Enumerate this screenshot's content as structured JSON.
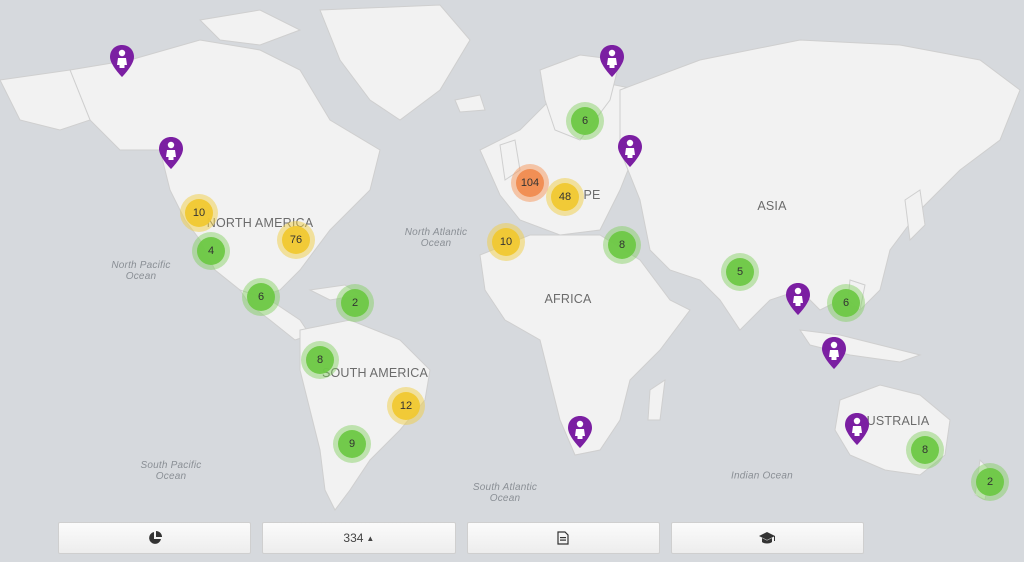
{
  "map": {
    "continents": [
      "NORTH AMERICA",
      "SOUTH AMERICA",
      "EUROPE",
      "AFRICA",
      "ASIA",
      "AUSTRALIA"
    ],
    "continent_labels": {
      "north_america": "NORTH AMERICA",
      "south_america": "SOUTH AMERICA",
      "europe": "PE",
      "africa": "AFRICA",
      "asia": "ASIA",
      "australia": "USTRALIA"
    },
    "oceans": {
      "north_pacific": "North Pacific\nOcean",
      "south_pacific": "South Pacific\nOcean",
      "north_atlantic": "North Atlantic\nOcean",
      "south_atlantic": "South Atlantic\nOcean",
      "indian": "Indian Ocean"
    },
    "clusters": [
      {
        "id": "c1",
        "count": "10",
        "color": "yellow"
      },
      {
        "id": "c2",
        "count": "4",
        "color": "green"
      },
      {
        "id": "c3",
        "count": "76",
        "color": "yellow"
      },
      {
        "id": "c4",
        "count": "6",
        "color": "green"
      },
      {
        "id": "c5",
        "count": "2",
        "color": "green"
      },
      {
        "id": "c6",
        "count": "8",
        "color": "green"
      },
      {
        "id": "c7",
        "count": "12",
        "color": "yellow"
      },
      {
        "id": "c8",
        "count": "9",
        "color": "green"
      },
      {
        "id": "c9",
        "count": "6",
        "color": "green"
      },
      {
        "id": "c10",
        "count": "104",
        "color": "orange"
      },
      {
        "id": "c11",
        "count": "48",
        "color": "yellow"
      },
      {
        "id": "c12",
        "count": "10",
        "color": "yellow"
      },
      {
        "id": "c13",
        "count": "8",
        "color": "green"
      },
      {
        "id": "c14",
        "count": "5",
        "color": "green"
      },
      {
        "id": "c15",
        "count": "6",
        "color": "green"
      },
      {
        "id": "c16",
        "count": "8",
        "color": "green"
      },
      {
        "id": "c17",
        "count": "2",
        "color": "green"
      }
    ],
    "pin_icon": "person-marker-icon",
    "pin_color": "#7b1fa2"
  },
  "toolbar": {
    "chart_button_icon": "pie-chart-icon",
    "count_label": "334",
    "count_caret": "▲",
    "document_button_icon": "document-icon",
    "education_button_icon": "graduation-cap-icon"
  },
  "colors": {
    "water": "#d6d9dd",
    "land": "#f2f2f2",
    "green": "#6ec846",
    "yellow": "#f0c832",
    "orange": "#f08c50"
  }
}
